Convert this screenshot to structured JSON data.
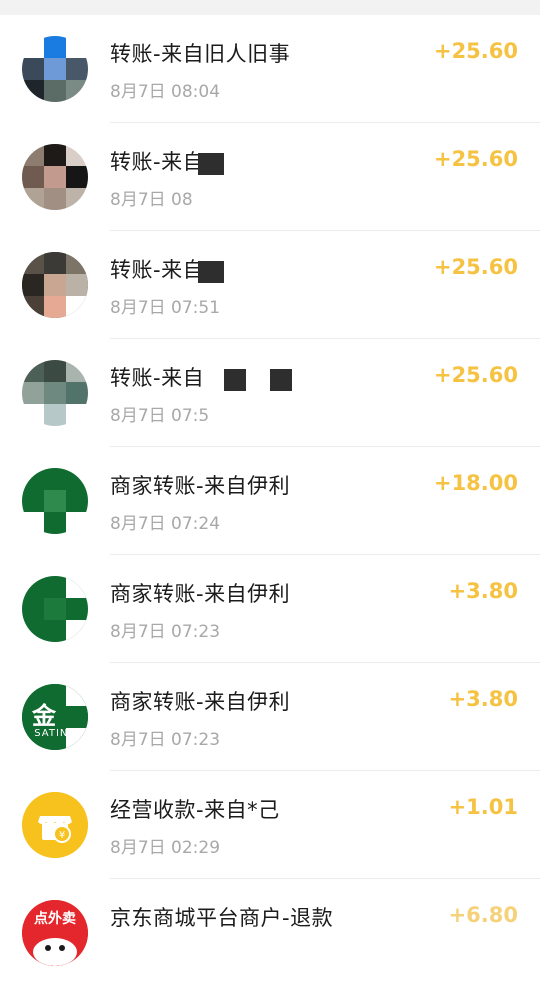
{
  "theme": {
    "amount_color": "#f5c242",
    "title_color": "#1c1c1c",
    "date_color": "#a8a8a8",
    "divider_color": "#ececec"
  },
  "transactions": [
    {
      "title": "转账-来自旧人旧事",
      "date": "8月7日 08:04",
      "amount": "+25.60",
      "avatar_icon": "user-photo-avatar"
    },
    {
      "title": "转账-来自",
      "date": "8月7日 08",
      "amount": "+25.60",
      "avatar_icon": "user-photo-avatar"
    },
    {
      "title": "转账-来自",
      "date": "8月7日 07:51",
      "amount": "+25.60",
      "avatar_icon": "user-photo-avatar"
    },
    {
      "title": "转账-来自",
      "date": "8月7日 07:5",
      "amount": "+25.60",
      "avatar_icon": "user-photo-avatar"
    },
    {
      "title": "商家转账-来自伊利",
      "date": "8月7日 07:24",
      "amount": "+18.00",
      "avatar_icon": "yili-logo-avatar"
    },
    {
      "title": "商家转账-来自伊利",
      "date": "8月7日 07:23",
      "amount": "+3.80",
      "avatar_icon": "yili-logo-avatar"
    },
    {
      "title": "商家转账-来自伊利",
      "date": "8月7日 07:23",
      "amount": "+3.80",
      "avatar_icon": "satine-logo-avatar",
      "brand_label": "SATINE",
      "brand_glyph": "金"
    },
    {
      "title": "经营收款-来自*己",
      "date": "8月7日 02:29",
      "amount": "+1.01",
      "avatar_icon": "merchant-payment-icon"
    },
    {
      "title": "京东商城平台商户-退款",
      "date": "",
      "amount": "+6.80",
      "avatar_icon": "jd-food-delivery-logo",
      "brand_label": "点外卖"
    }
  ]
}
